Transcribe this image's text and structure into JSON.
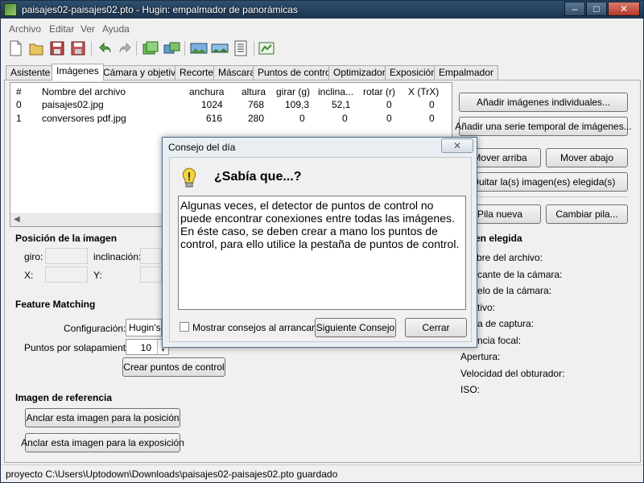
{
  "window": {
    "title": "paisajes02-paisajes02.pto - Hugin: empalmador de panorámicas"
  },
  "menu": [
    "Archivo",
    "Editar",
    "Ver",
    "Ayuda"
  ],
  "tabs": [
    "Asistente",
    "Imágenes",
    "Cámara y objetivo",
    "Recorte",
    "Máscara",
    "Puntos de control",
    "Optimizador",
    "Exposición",
    "Empalmador"
  ],
  "active_tab": "Imágenes",
  "image_list": {
    "headers": [
      "#",
      "Nombre del archivo",
      "anchura",
      "altura",
      "girar (g)",
      "inclina...",
      "rotar (r)",
      "X (TrX)"
    ],
    "rows": [
      [
        "0",
        "paisajes02.jpg",
        "1024",
        "768",
        "109,3",
        "52,1",
        "0",
        "0"
      ],
      [
        "1",
        "conversores pdf.jpg",
        "616",
        "280",
        "0",
        "0",
        "0",
        "0"
      ]
    ]
  },
  "right_buttons": {
    "add_individual": "Añadir imágenes individuales...",
    "add_series": "Añadir una serie temporal de imágenes...",
    "move_up": "Mover arriba",
    "move_down": "Mover abajo",
    "remove": "Quitar la(s) imagen(es) elegida(s)",
    "new_stack": "Pila nueva",
    "change_stack": "Cambiar pila..."
  },
  "selected_image": {
    "heading": "en elegida",
    "fields": [
      "bre del archivo:",
      "cante de la cámara:",
      "elo de la cámara:",
      "tivo:",
      "a de captura:",
      "ncia focal:",
      "Apertura:",
      "Velocidad del obturador:",
      "ISO:"
    ]
  },
  "position": {
    "heading": "Posición de la imagen",
    "giro": "giro:",
    "inclinacion": "inclinación:",
    "x": "X:",
    "y": "Y:"
  },
  "feature_matching": {
    "heading": "Feature Matching",
    "config_label": "Configuración:",
    "config_value": "Hugin's C",
    "points_label": "Puntos por solapamiento:",
    "points_value": "10",
    "create_button": "Crear puntos de control"
  },
  "reference": {
    "heading": "Imagen de referencia",
    "anchor_position": "Anclar esta imagen para la posición",
    "anchor_exposure": "Anclar esta imagen para la exposición"
  },
  "status_text": "proyecto C:\\Users\\Uptodown\\Downloads\\paisajes02-paisajes02.pto guardado",
  "dialog": {
    "title": "Consejo del día",
    "heading": "¿Sabía que...?",
    "tip": "Algunas veces, el detector de puntos de control no puede encontrar conexiones entre todas las imágenes. En éste caso, se deben crear a mano los puntos de control, para ello utilice la pestaña de puntos de control.",
    "checkbox_label": "Mostrar consejos al arrancar",
    "next_button": "Siguiente Consejo",
    "close_button": "Cerrar"
  },
  "colors": {
    "titlebar": "#1d3550",
    "list_bg": "#ffffff",
    "panel_bg": "#f0f0f0"
  }
}
